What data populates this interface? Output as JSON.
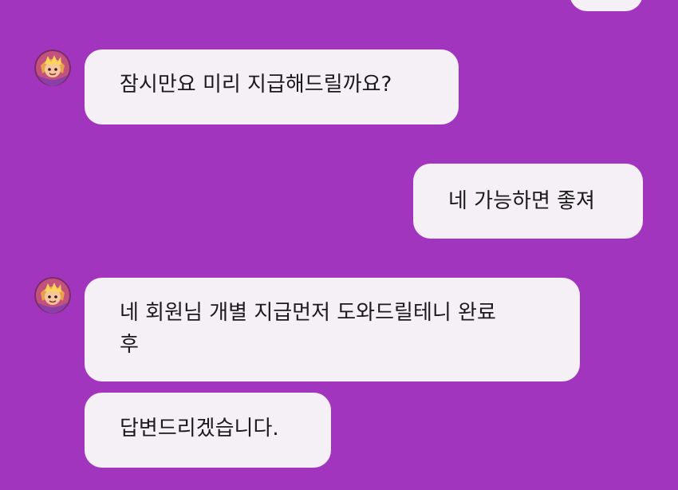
{
  "conversation": {
    "messages": [
      {
        "sender": "me",
        "text": ""
      },
      {
        "sender": "agent",
        "text": "잠시만요 미리 지급해드릴까요?"
      },
      {
        "sender": "me",
        "text": "네 가능하면 좋져"
      },
      {
        "sender": "agent",
        "text": "네 회원님 개별 지급먼저 도와드릴테니 완료\n후"
      },
      {
        "sender": "agent",
        "text": "답변드리겠습니다."
      }
    ]
  },
  "avatar": {
    "icon": "character-avatar-icon"
  },
  "colors": {
    "background": "#a235bd",
    "bubble": "#f5eff6",
    "text": "#1a1a1a"
  }
}
